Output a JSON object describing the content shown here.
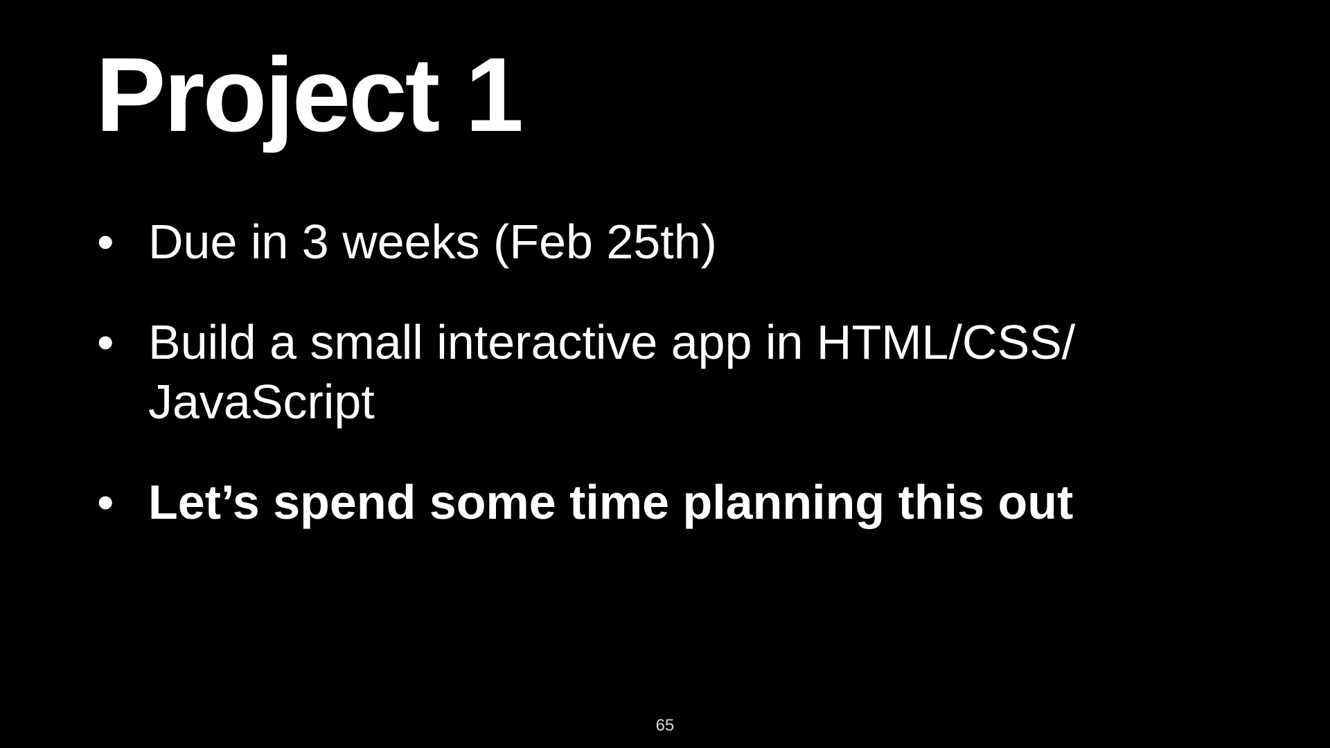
{
  "slide": {
    "title": "Project 1",
    "bullet_symbol": "•",
    "bullets": [
      {
        "text": "Due in 3 weeks (Feb 25th)"
      },
      {
        "text": "Build a small interactive app in HTML/CSS/ JavaScript"
      },
      {
        "text": "Let’s spend some time planning this out"
      }
    ],
    "page_number": "65"
  },
  "colors": {
    "background": "#000000",
    "text": "#ffffff"
  }
}
